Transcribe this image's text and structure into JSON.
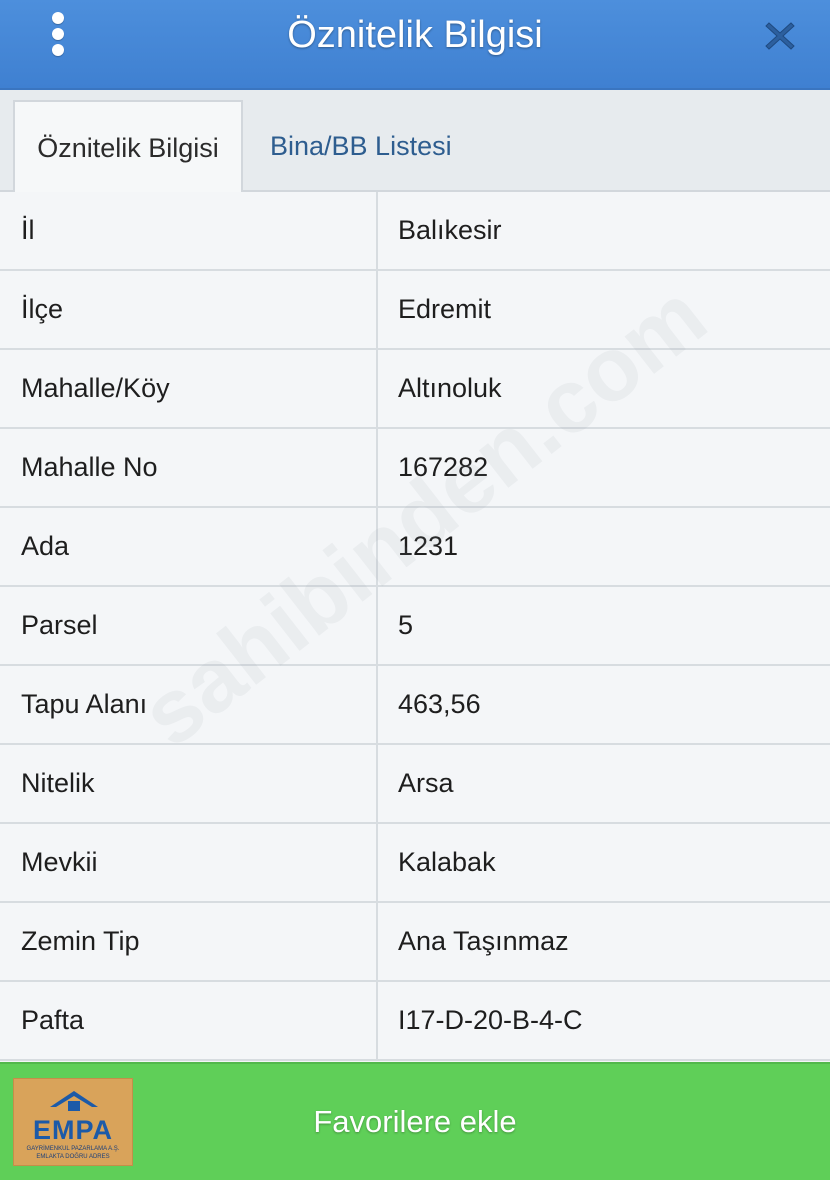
{
  "header": {
    "title": "Öznitelik Bilgisi",
    "menu_icon": "vertical-dots-icon",
    "close_icon": "close-icon",
    "bar_color": "#4a8bd8"
  },
  "tabs": [
    {
      "label": "Öznitelik Bilgisi",
      "active": true
    },
    {
      "label": "Bina/BB Listesi",
      "active": false
    }
  ],
  "attributes": [
    {
      "key": "İl",
      "value": "Balıkesir"
    },
    {
      "key": "İlçe",
      "value": "Edremit"
    },
    {
      "key": "Mahalle/Köy",
      "value": "Altınoluk"
    },
    {
      "key": "Mahalle No",
      "value": "167282"
    },
    {
      "key": "Ada",
      "value": "1231"
    },
    {
      "key": "Parsel",
      "value": "5"
    },
    {
      "key": "Tapu Alanı",
      "value": "463,56"
    },
    {
      "key": "Nitelik",
      "value": "Arsa"
    },
    {
      "key": "Mevkii",
      "value": "Kalabak"
    },
    {
      "key": "Zemin Tip",
      "value": "Ana Taşınmaz"
    },
    {
      "key": "Pafta",
      "value": "I17-D-20-B-4-C"
    }
  ],
  "footer": {
    "favorite_label": "Favorilere ekle",
    "button_color": "#5fcf58",
    "logo": {
      "name": "EMPA",
      "subtitle": "GAYRİMENKUL PAZARLAMA A.Ş.",
      "tagline": "EMLAKTA DOĞRU ADRES"
    }
  },
  "watermark": "sahibinden.com"
}
